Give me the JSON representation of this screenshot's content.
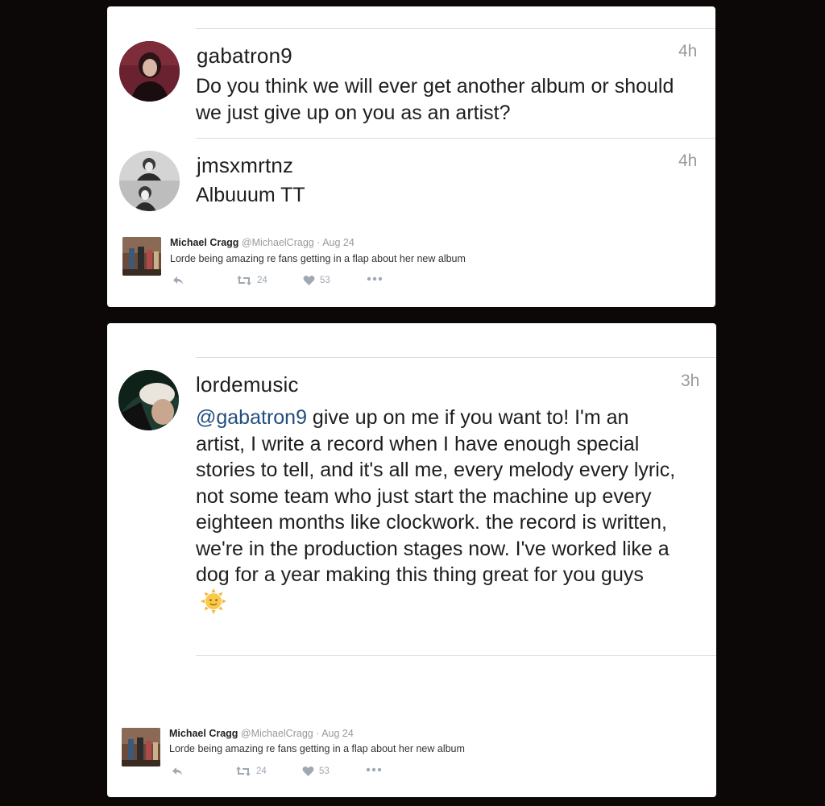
{
  "replies": [
    {
      "username": "gabatron9",
      "time": "4h",
      "text": "Do you think we will ever get another album or should we just give up on you as an artist?"
    },
    {
      "username": "jmsxmrtnz",
      "time": "4h",
      "text": "Albuuum TT"
    }
  ],
  "response": {
    "username": "lordemusic",
    "time": "3h",
    "mention": "@gabatron9",
    "text": " give up on me if you want to! I'm an artist, I write a record when I have enough special stories to tell, and it's all me, every melody every lyric, not some team who just start the machine up every eighteen months like clockwork. the record is written, we're in the production stages now. I've worked like a dog for a year making this thing great for you guys",
    "emoji": "sun-with-face-emoji"
  },
  "embed": {
    "author": "Michael Cragg",
    "handle": "@MichaelCragg",
    "date": "Aug 24",
    "separator": "·",
    "text": "Lorde being amazing re fans getting in a flap about her new album",
    "retweets": "24",
    "likes": "53"
  },
  "icons": [
    "reply-icon",
    "retweet-icon",
    "heart-icon",
    "more-icon"
  ],
  "colors": {
    "mention": "#234e7d",
    "time": "#9a9a9a",
    "background": "#0b0807",
    "action": "#9fa8b3"
  }
}
